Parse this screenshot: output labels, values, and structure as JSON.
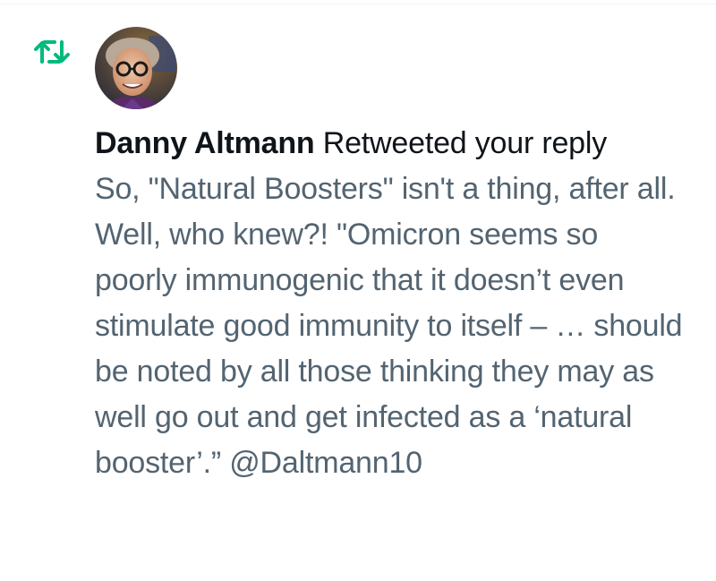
{
  "notification": {
    "type_icon": "retweet-icon",
    "avatar_icon": "user-avatar",
    "actor_name": "Danny Altmann",
    "action_text": " Retweeted your reply",
    "tweet_text": "So, \"Natural Boosters\" isn't a thing, after all. Well, who knew?! \"Omicron seems so poorly immunogenic that it doesn’t even stimulate good immunity to itself – … should be noted by all those thinking they may as well go out and get infected as a ‘natural booster’.” @Daltmann10"
  },
  "colors": {
    "retweet_green": "#00ba7c",
    "primary_text": "#0f1419",
    "secondary_text": "#536471",
    "background": "#ffffff"
  }
}
